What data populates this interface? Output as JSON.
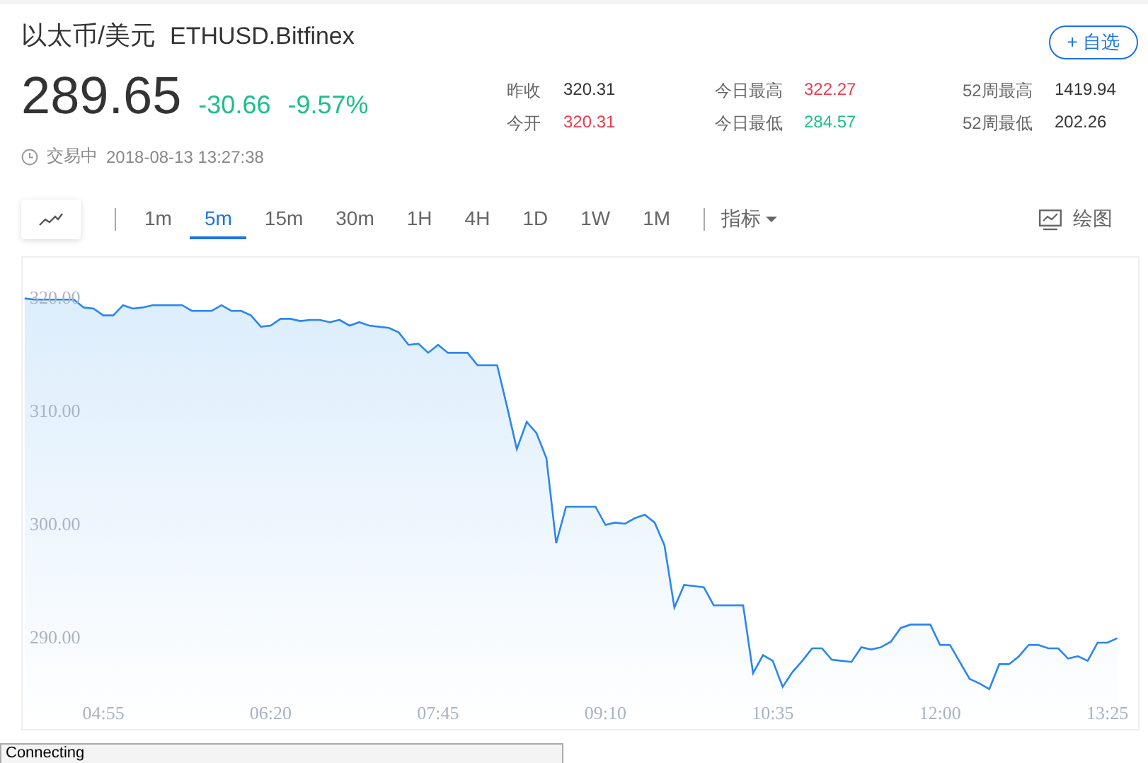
{
  "header": {
    "name": "以太币/美元",
    "symbol": "ETHUSD.Bitfinex",
    "watch_button": "+ 自选"
  },
  "quote": {
    "price": "289.65",
    "change": "-30.66",
    "change_pct": "-9.57%",
    "color": "#1bbf8a"
  },
  "stats": [
    {
      "label": "昨收",
      "value": "320.31",
      "color": "#333333"
    },
    {
      "label": "今日最高",
      "value": "322.27",
      "color": "#f0394d"
    },
    {
      "label": "52周最高",
      "value": "1419.94",
      "color": "#333333"
    },
    {
      "label": "今开",
      "value": "320.31",
      "color": "#f0394d"
    },
    {
      "label": "今日最低",
      "value": "284.57",
      "color": "#1bbf8a"
    },
    {
      "label": "52周最低",
      "value": "202.26",
      "color": "#333333"
    }
  ],
  "status": {
    "state": "交易中",
    "time": "2018-08-13 13:27:38"
  },
  "toolbar": {
    "intervals": [
      {
        "label": "1m",
        "selected": false
      },
      {
        "label": "5m",
        "selected": true
      },
      {
        "label": "15m",
        "selected": false
      },
      {
        "label": "30m",
        "selected": false
      },
      {
        "label": "1H",
        "selected": false
      },
      {
        "label": "4H",
        "selected": false
      },
      {
        "label": "1D",
        "selected": false
      },
      {
        "label": "1W",
        "selected": false
      },
      {
        "label": "1M",
        "selected": false
      }
    ],
    "indicators": "指标",
    "draw": "绘图"
  },
  "chart": {
    "chart_data": {
      "type": "area",
      "xlim": [
        254,
        822
      ],
      "ylim": [
        282,
        323.5
      ],
      "yticks": [
        {
          "value": 320,
          "label": "320.00"
        },
        {
          "value": 310,
          "label": "310.00"
        },
        {
          "value": 300,
          "label": "300.00"
        },
        {
          "value": 290,
          "label": "290.00"
        }
      ],
      "xticks": [
        {
          "value": 295,
          "label": "04:55"
        },
        {
          "value": 380,
          "label": "06:20"
        },
        {
          "value": 465,
          "label": "07:45"
        },
        {
          "value": 550,
          "label": "09:10"
        },
        {
          "value": 635,
          "label": "10:35"
        },
        {
          "value": 720,
          "label": "12:00"
        },
        {
          "value": 805,
          "label": "13:25"
        }
      ],
      "x": [
        255,
        260,
        265,
        270,
        275,
        280,
        285,
        290,
        295,
        300,
        305,
        310,
        315,
        320,
        325,
        330,
        335,
        340,
        345,
        350,
        355,
        360,
        365,
        370,
        375,
        380,
        385,
        390,
        395,
        400,
        405,
        410,
        415,
        420,
        425,
        430,
        435,
        440,
        445,
        450,
        455,
        460,
        465,
        470,
        475,
        480,
        485,
        490,
        495,
        500,
        505,
        510,
        515,
        520,
        525,
        530,
        535,
        540,
        545,
        550,
        555,
        560,
        565,
        570,
        575,
        580,
        585,
        590,
        595,
        600,
        605,
        610,
        615,
        620,
        625,
        630,
        635,
        640,
        645,
        650,
        655,
        660,
        665,
        670,
        675,
        680,
        685,
        690,
        695,
        700,
        705,
        710,
        715,
        720,
        725,
        730,
        735,
        740,
        745,
        750,
        755,
        760,
        765,
        770,
        775,
        780,
        785,
        790,
        795,
        800,
        805,
        810
      ],
      "series": [
        {
          "color": "#2a86f0",
          "values": [
            319.9,
            319.8,
            319.8,
            319.8,
            319.8,
            319.8,
            319.1,
            319.0,
            318.4,
            318.4,
            319.3,
            319.0,
            319.1,
            319.3,
            319.3,
            319.3,
            319.3,
            318.8,
            318.8,
            318.8,
            319.3,
            318.8,
            318.8,
            318.4,
            317.4,
            317.5,
            318.1,
            318.1,
            317.9,
            318.0,
            318.0,
            317.8,
            318.0,
            317.5,
            317.8,
            317.5,
            317.4,
            317.3,
            316.9,
            315.8,
            315.9,
            315.1,
            315.8,
            315.1,
            315.1,
            315.1,
            314.0,
            314.0,
            314.0,
            310.4,
            306.6,
            309.0,
            308.0,
            305.8,
            298.3,
            301.5,
            301.5,
            301.5,
            301.5,
            299.9,
            300.1,
            300.0,
            300.5,
            300.8,
            300.1,
            298.1,
            292.6,
            294.6,
            294.5,
            294.4,
            292.8,
            292.8,
            292.8,
            292.8,
            286.8,
            288.4,
            287.9,
            285.6,
            286.9,
            287.9,
            289.0,
            289.0,
            288.0,
            287.9,
            287.8,
            289.1,
            288.9,
            289.1,
            289.6,
            290.8,
            291.1,
            291.1,
            291.1,
            289.3,
            289.3,
            287.8,
            286.3,
            285.9,
            285.4,
            287.6,
            287.6,
            288.3,
            289.3,
            289.3,
            289.0,
            289.0,
            288.1,
            288.3,
            287.9,
            289.5,
            289.5,
            289.9
          ]
        }
      ]
    }
  },
  "status_bar": {
    "text": "Connecting"
  }
}
